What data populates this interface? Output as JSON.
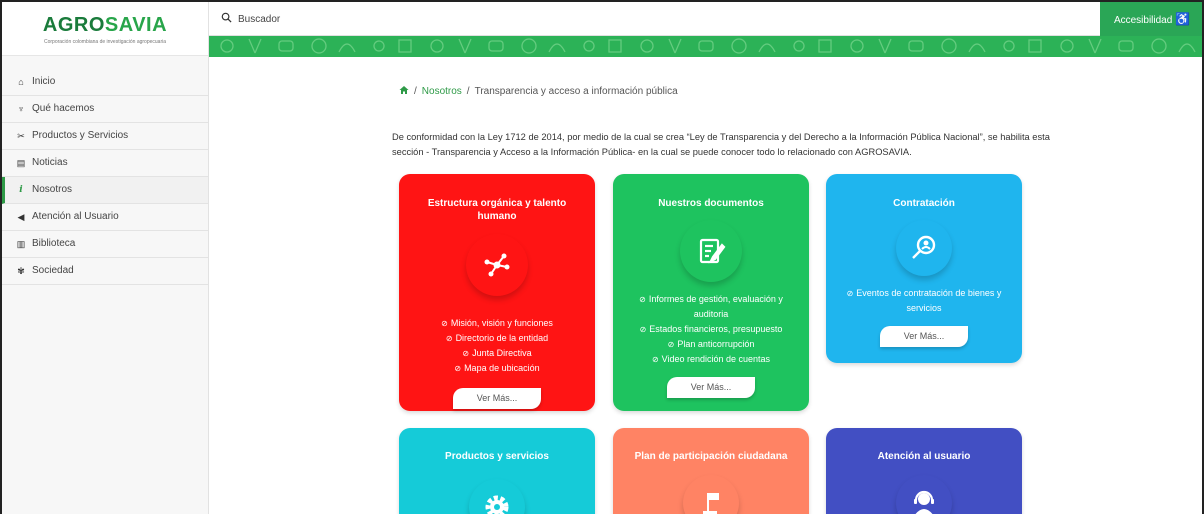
{
  "brand": {
    "name_part1": "AGRO",
    "name_part2": "SAVIA",
    "tagline": "Corporación colombiana de investigación agropecuaria"
  },
  "search": {
    "placeholder": "Buscador",
    "icon": "search-icon"
  },
  "accessibility": {
    "label": "Accesibilidad",
    "icon": "wheelchair-icon"
  },
  "sidebar": {
    "items": [
      {
        "label": "Inicio",
        "icon": "home-icon",
        "glyph": "⌂"
      },
      {
        "label": "Qué hacemos",
        "icon": "plant-icon",
        "glyph": "♆"
      },
      {
        "label": "Productos y Servicios",
        "icon": "tools-icon",
        "glyph": "✂"
      },
      {
        "label": "Noticias",
        "icon": "newspaper-icon",
        "glyph": "▤"
      },
      {
        "label": "Nosotros",
        "icon": "info-icon",
        "glyph": "i",
        "active": true
      },
      {
        "label": "Atención al Usuario",
        "icon": "megaphone-icon",
        "glyph": "◀"
      },
      {
        "label": "Biblioteca",
        "icon": "library-icon",
        "glyph": "▥"
      },
      {
        "label": "Sociedad",
        "icon": "society-icon",
        "glyph": "✾"
      }
    ]
  },
  "breadcrumb": {
    "home_icon": "home-icon",
    "sep": "/",
    "link": "Nosotros",
    "current": "Transparencia y acceso a información pública"
  },
  "intro": "De conformidad con la Ley 1712 de 2014, por medio de la cual se crea “Ley de Transparencia y del Derecho a la Información Pública Nacional”, se habilita esta sección - Transparencia y Acceso a la Información Pública- en la cual se puede conocer todo lo relacionado con AGROSAVIA.",
  "cards": [
    {
      "title": "Estructura orgánica y talento humano",
      "color": "#ff1414",
      "icon": "network-icon",
      "items": [
        "Misión, visión y funciones",
        "Directorio de la entidad",
        "Junta Directiva",
        "Mapa de ubicación"
      ],
      "button": "Ver Más..."
    },
    {
      "title": "Nuestros documentos",
      "color": "#1ec35f",
      "icon": "document-edit-icon",
      "items": [
        "Informes de gestión, evaluación y auditoria",
        "Estados financieros, presupuesto",
        "Plan anticorrupción",
        "Video rendición de cuentas"
      ],
      "button": "Ver Más..."
    },
    {
      "title": "Contratación",
      "color": "#1fb5ee",
      "icon": "user-search-icon",
      "items": [
        "Eventos de contratación de bienes y servicios"
      ],
      "button": "Ver Más..."
    },
    {
      "title": "Productos y servicios",
      "color": "#15cbd8",
      "icon": "gear-icon"
    },
    {
      "title": "Plan de participación ciudadana",
      "color": "#ff8364",
      "icon": "flag-podium-icon"
    },
    {
      "title": "Atención al usuario",
      "color": "#424fc3",
      "icon": "headset-user-icon"
    }
  ]
}
